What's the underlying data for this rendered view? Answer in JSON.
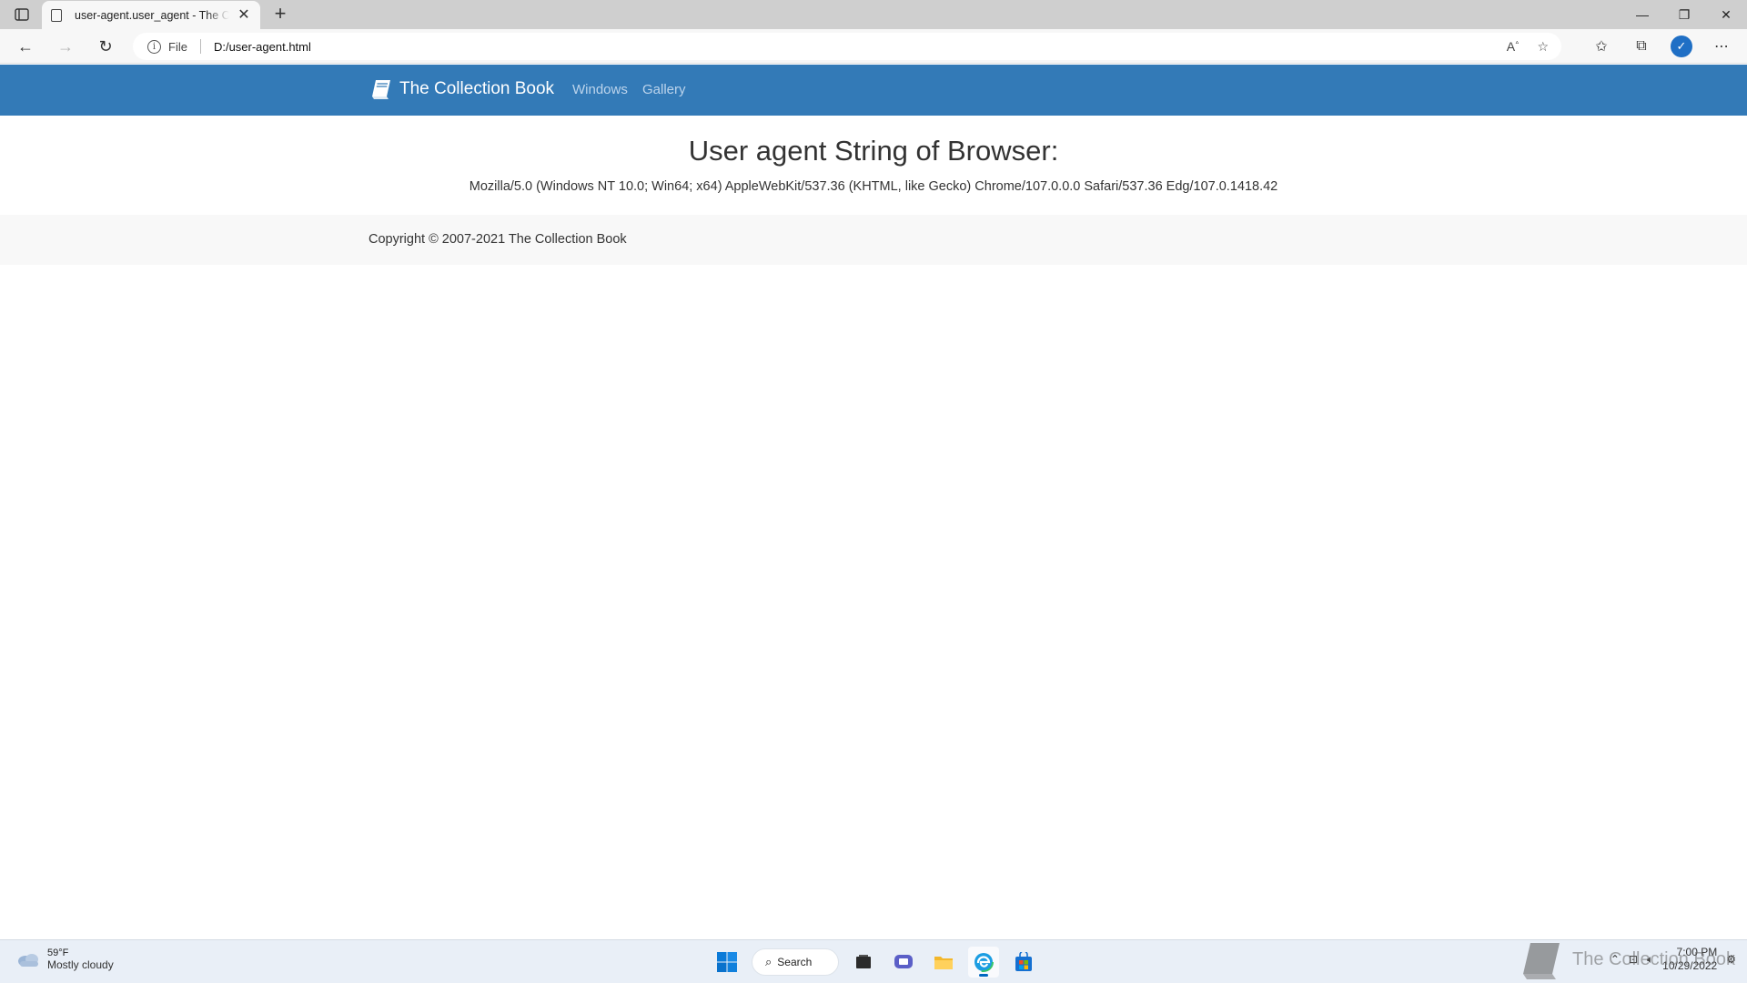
{
  "browser": {
    "tab_title": "user-agent.user_agent - The Collection Book",
    "address_scheme_label": "File",
    "url": "D:/user-agent.html"
  },
  "site": {
    "brand": "The Collection Book",
    "nav": [
      "Windows",
      "Gallery"
    ],
    "heading": "User agent String of Browser:",
    "user_agent": "Mozilla/5.0 (Windows NT 10.0; Win64; x64) AppleWebKit/537.36 (KHTML, like Gecko) Chrome/107.0.0.0 Safari/537.36 Edg/107.0.1418.42",
    "copyright": "Copyright © 2007-2021 The Collection Book",
    "navbar_color": "#337ab7"
  },
  "taskbar": {
    "weather_temp": "59°F",
    "weather_condition": "Mostly cloudy",
    "search_label": "Search",
    "time": "7:00 PM",
    "date": "10/29/2022"
  },
  "watermark": {
    "text": "The Collection Book"
  }
}
